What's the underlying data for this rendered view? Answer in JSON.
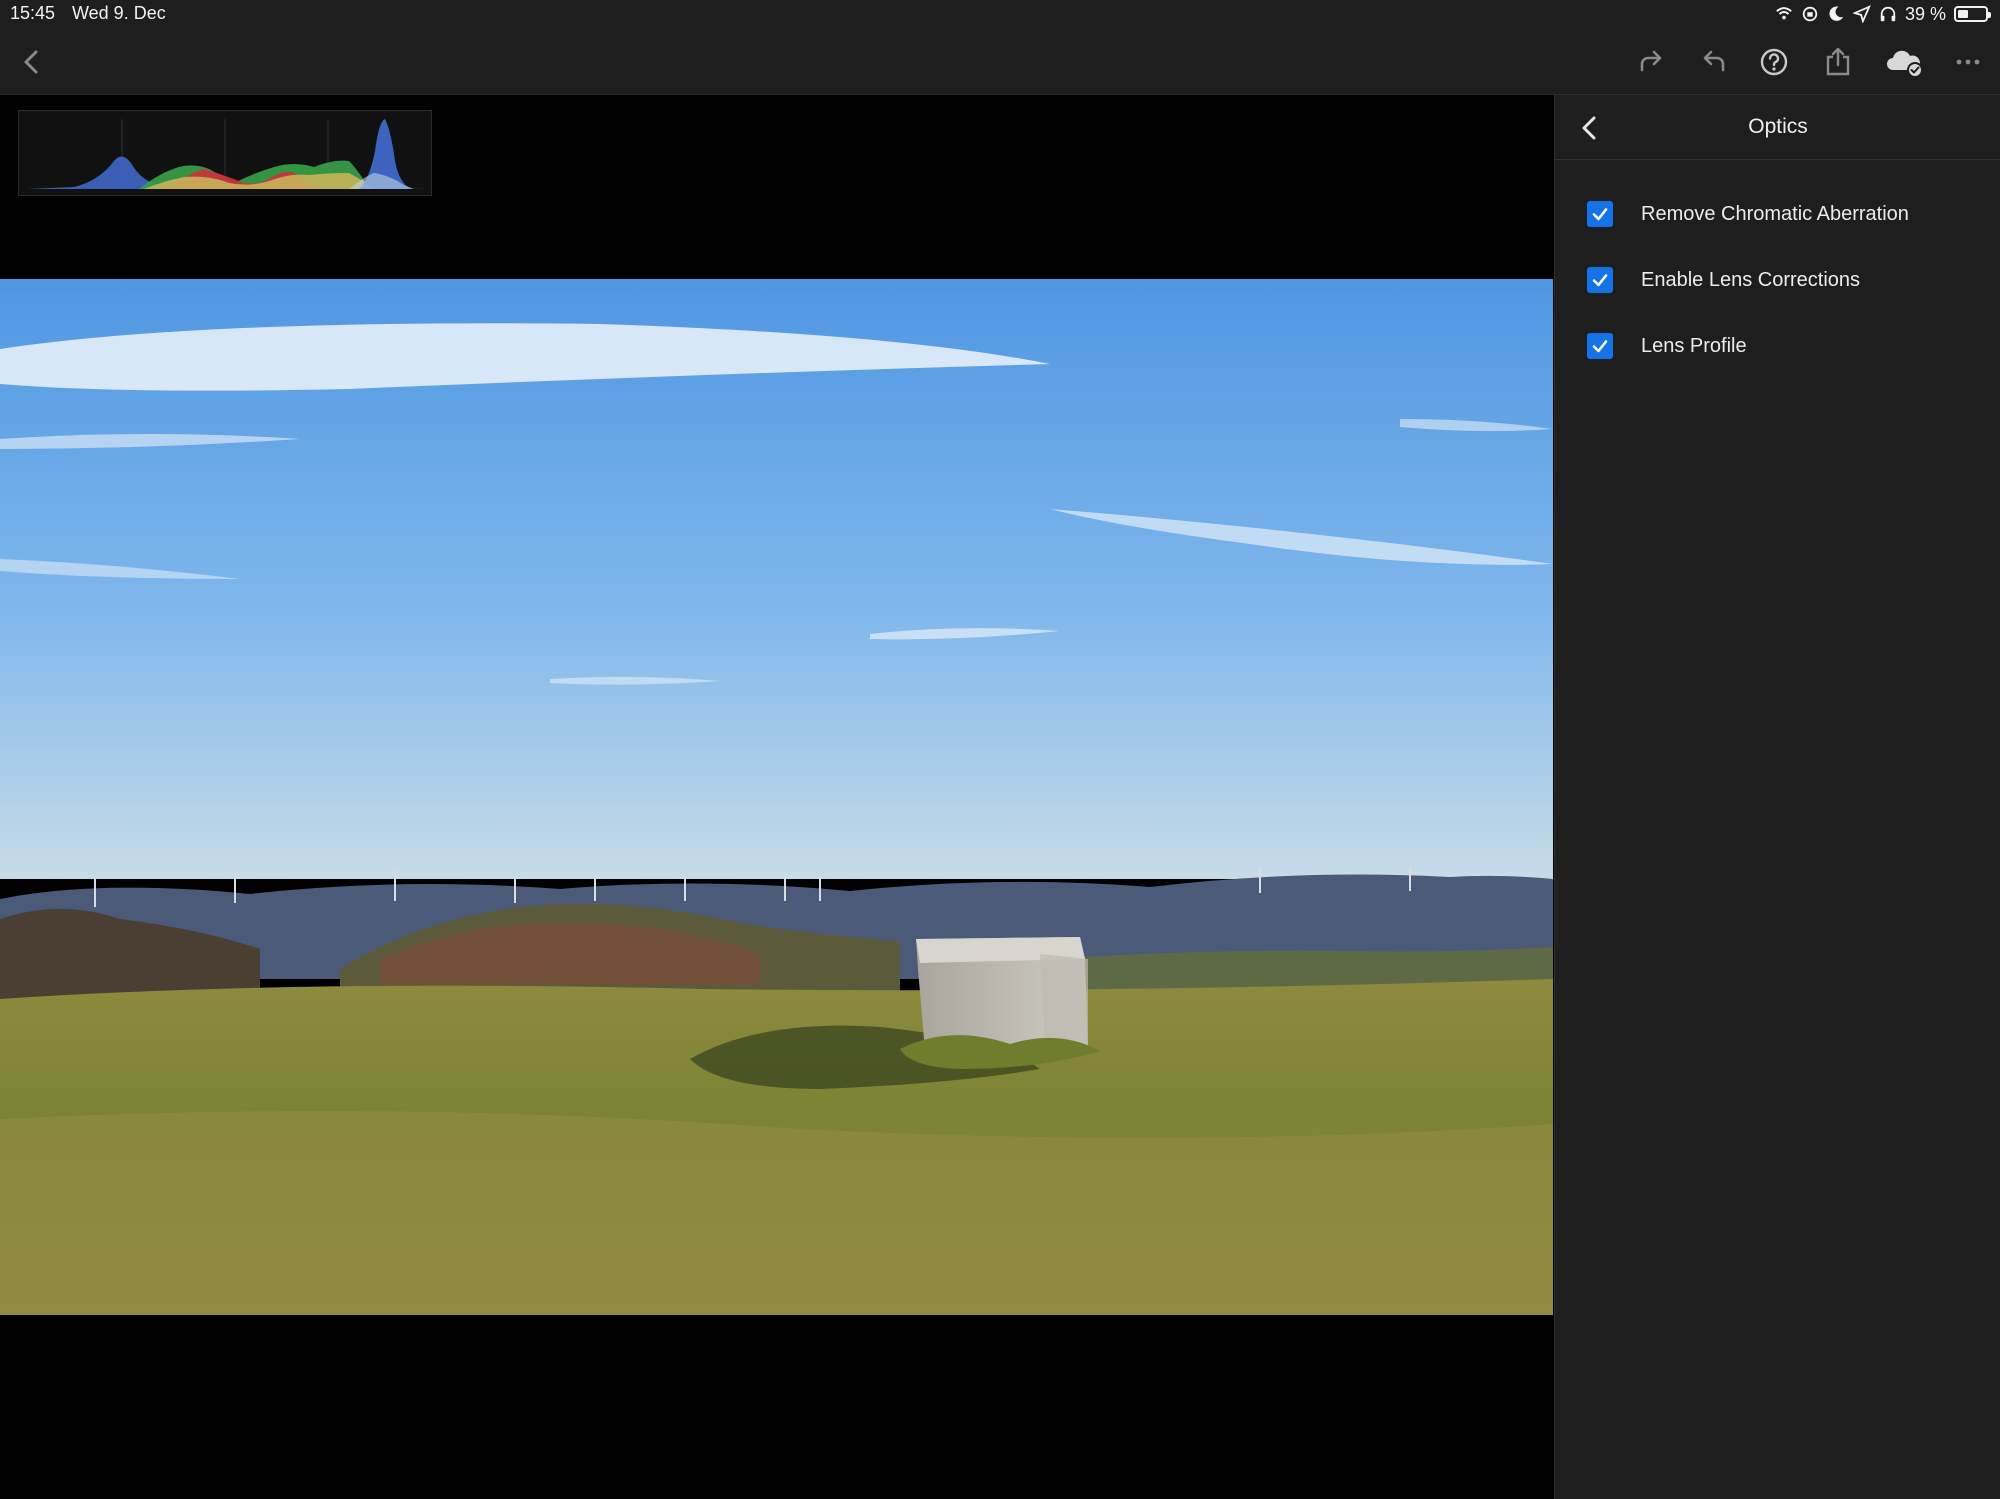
{
  "status_bar": {
    "time": "15:45",
    "date": "Wed 9. Dec",
    "battery_text": "39 %",
    "battery_level": 0.39,
    "icons": [
      "wifi-icon",
      "screen-rotation-lock-icon",
      "moon-icon",
      "location-icon",
      "headphones-icon"
    ]
  },
  "toolbar": {
    "left_icons": [
      "back-icon"
    ],
    "right_icons": [
      "redo-icon",
      "undo-icon",
      "help-icon",
      "share-icon",
      "cloud-sync-icon",
      "more-icon"
    ]
  },
  "histogram": {
    "channels": [
      "blue",
      "green",
      "red",
      "yellow"
    ],
    "colors": {
      "blue": "#3f68c8",
      "green": "#3aa34a",
      "red": "#c8343a",
      "yellow": "#c9b25a"
    }
  },
  "panel": {
    "title": "Optics",
    "options": [
      {
        "label": "Remove Chromatic Aberration",
        "checked": true
      },
      {
        "label": "Enable Lens Corrections",
        "checked": true
      },
      {
        "label": "Lens Profile",
        "checked": true
      }
    ]
  },
  "colors": {
    "accent": "#1473e6",
    "panel_bg": "#1e1e1e",
    "canvas_bg": "#000000"
  }
}
